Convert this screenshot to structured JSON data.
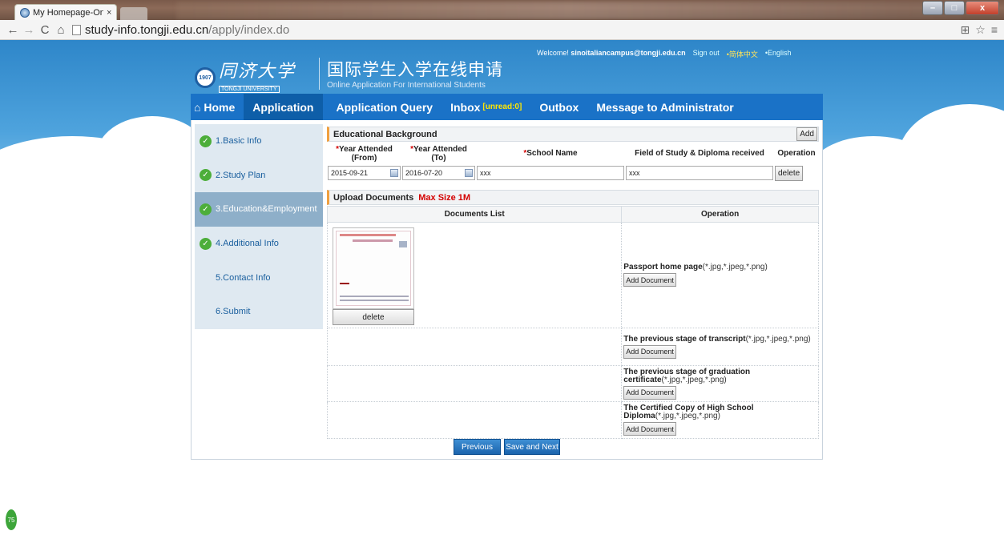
{
  "browser": {
    "tab_title": "My Homepage-Online S",
    "tab_close": "×",
    "url_host": "study-info.tongji.edu.cn",
    "url_path": "/apply/index.do",
    "win_min": "–",
    "win_max": "□",
    "win_close": "x"
  },
  "header": {
    "logo_cn": "同济大学",
    "logo_en": "TONGJI UNIVERSITY",
    "logo_seal": "1907",
    "title_cn": "国际学生入学在线申请",
    "title_en": "Online Application For International Students",
    "welcome_label": "Welcome!",
    "user_email": "sinoitaliancampus@tongji.edu.cn",
    "sign_out": "Sign out",
    "lang_cn": "•简体中文",
    "lang_en": "•English"
  },
  "nav": {
    "home": "Home",
    "application": "Application",
    "query": "Application Query",
    "inbox": "Inbox",
    "inbox_unread": "[unread:0]",
    "outbox": "Outbox",
    "message": "Message to Administrator"
  },
  "sidebar": {
    "items": [
      {
        "label": "1.Basic Info",
        "done": true
      },
      {
        "label": "2.Study Plan",
        "done": true
      },
      {
        "label": "3.Education&Employment",
        "done": true
      },
      {
        "label": "4.Additional Info",
        "done": true
      },
      {
        "label": "5.Contact Info",
        "done": false
      },
      {
        "label": "6.Submit",
        "done": false
      }
    ]
  },
  "education": {
    "heading": "Educational Background",
    "add_label": "Add",
    "col_from": "Year Attended (From)",
    "col_to": "Year Attended (To)",
    "col_school": "School Name",
    "col_field": "Field of Study & Diploma received",
    "col_op": "Operation",
    "req_mark": "*",
    "row": {
      "from": "2015-09-21",
      "to": "2016-07-20",
      "school": "xxx",
      "field": "xxx",
      "delete_label": "delete"
    }
  },
  "upload": {
    "heading": "Upload Documents",
    "max_size": "Max Size 1M",
    "col_list": "Documents List",
    "col_op": "Operation",
    "thumb_delete": "delete",
    "add_doc_label": "Add Document",
    "docs": [
      {
        "name": "Passport home page",
        "formats": "(*.jpg,*.jpeg,*.png)"
      },
      {
        "name": "The previous stage of transcript",
        "formats": "(*.jpg,*.jpeg,*.png)"
      },
      {
        "name": "The previous stage of graduation certificate",
        "formats": "(*.jpg,*.jpeg,*.png)"
      },
      {
        "name": "The Certified Copy of High School Diploma",
        "formats": "(*.jpg,*.jpeg,*.png)"
      }
    ]
  },
  "actions": {
    "previous": "Previous",
    "save_next": "Save and Next"
  },
  "badge": {
    "text": "75"
  },
  "colors": {
    "nav_bg": "#1a72c7",
    "sky": "#2e86c9",
    "required": "#d40000",
    "unread": "#ffe600",
    "sidebar_active": "#8eafc9"
  }
}
